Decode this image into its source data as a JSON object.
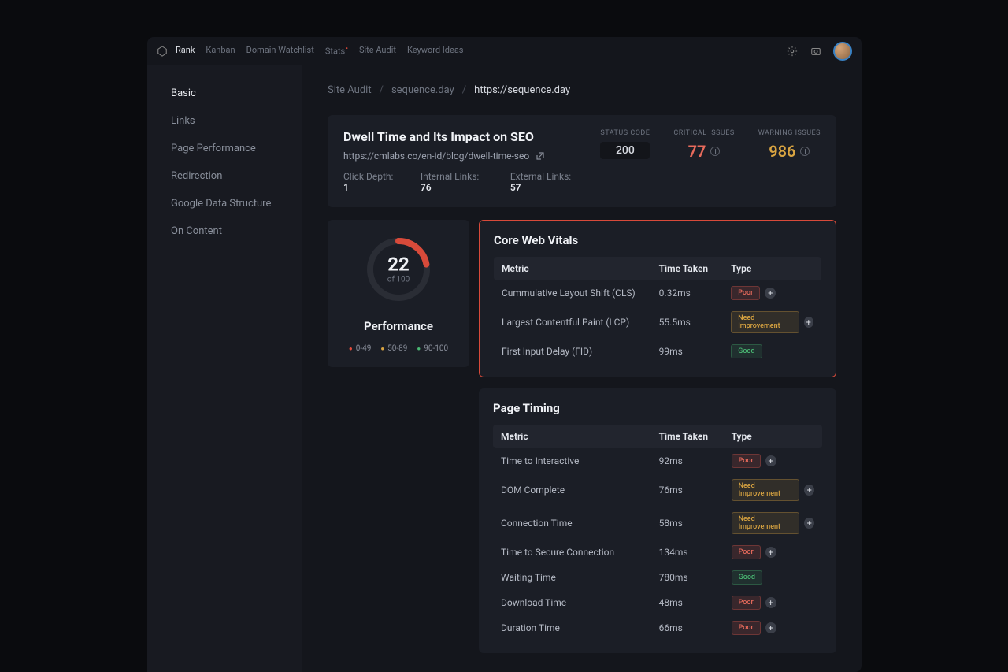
{
  "topnav": {
    "items": [
      {
        "label": "Rank",
        "active": true
      },
      {
        "label": "Kanban"
      },
      {
        "label": "Domain Watchlist"
      },
      {
        "label": "Stats",
        "red_dot": true
      },
      {
        "label": "Site Audit"
      },
      {
        "label": "Keyword Ideas"
      }
    ]
  },
  "sidebar": {
    "items": [
      {
        "label": "Basic",
        "active": true
      },
      {
        "label": "Links"
      },
      {
        "label": "Page Performance"
      },
      {
        "label": "Redirection"
      },
      {
        "label": "Google Data Structure"
      },
      {
        "label": "On Content"
      }
    ]
  },
  "breadcrumb": {
    "parts": [
      "Site Audit",
      "sequence.day",
      "https://sequence.day"
    ]
  },
  "header": {
    "title": "Dwell Time and Its Impact on SEO",
    "url": "https://cmlabs.co/en-id/blog/dwell-time-seo",
    "meta": {
      "click_depth_label": "Click Depth:",
      "click_depth": "1",
      "internal_links_label": "Internal Links:",
      "internal_links": "76",
      "external_links_label": "External Links:",
      "external_links": "57"
    },
    "status": {
      "label": "STATUS CODE",
      "value": "200"
    },
    "critical": {
      "label": "CRITICAL ISSUES",
      "value": "77"
    },
    "warning": {
      "label": "WARNING ISSUES",
      "value": "986"
    }
  },
  "performance": {
    "score": "22",
    "sub": "of 100",
    "title": "Performance",
    "legend": [
      "0-49",
      "50-89",
      "90-100"
    ]
  },
  "core_web_vitals": {
    "title": "Core Web Vitals",
    "headers": {
      "metric": "Metric",
      "time": "Time Taken",
      "type": "Type"
    },
    "rows": [
      {
        "metric": "Cummulative Layout Shift (CLS)",
        "time": "0.32ms",
        "badge": "Poor",
        "badge_class": "poor",
        "plus": true
      },
      {
        "metric": "Largest Contentful Paint (LCP)",
        "time": "55.5ms",
        "badge": "Need Improvement",
        "badge_class": "need",
        "plus": true
      },
      {
        "metric": "First Input Delay (FID)",
        "time": "99ms",
        "badge": "Good",
        "badge_class": "good",
        "plus": false
      }
    ]
  },
  "page_timing": {
    "title": "Page Timing",
    "headers": {
      "metric": "Metric",
      "time": "Time Taken",
      "type": "Type"
    },
    "rows": [
      {
        "metric": "Time to Interactive",
        "time": "92ms",
        "badge": "Poor",
        "badge_class": "poor",
        "plus": true
      },
      {
        "metric": "DOM Complete",
        "time": "76ms",
        "badge": "Need Improvement",
        "badge_class": "need",
        "plus": true
      },
      {
        "metric": "Connection Time",
        "time": "58ms",
        "badge": "Need Improvement",
        "badge_class": "need",
        "plus": true
      },
      {
        "metric": "Time to Secure Connection",
        "time": "134ms",
        "badge": "Poor",
        "badge_class": "poor",
        "plus": true
      },
      {
        "metric": "Waiting Time",
        "time": "780ms",
        "badge": "Good",
        "badge_class": "good",
        "plus": false
      },
      {
        "metric": "Download Time",
        "time": "48ms",
        "badge": "Poor",
        "badge_class": "poor",
        "plus": true
      },
      {
        "metric": "Duration Time",
        "time": "66ms",
        "badge": "Poor",
        "badge_class": "poor",
        "plus": true
      }
    ]
  }
}
